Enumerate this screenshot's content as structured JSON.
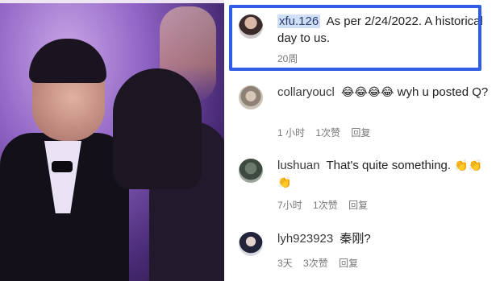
{
  "comments": [
    {
      "user": "xfu.126",
      "text": "As per 2/24/2022. A historical day to us.",
      "time": "20周",
      "likes": "",
      "reply": ""
    },
    {
      "user": "collaryoucl",
      "emoji": "😂😂😂😂",
      "text": "wyh u posted Q?",
      "time": "1 小时",
      "likes": "1次赞",
      "reply": "回复"
    },
    {
      "user": "lushuan",
      "text": "That's quite something.",
      "emoji": "👏👏👏",
      "time": "7小时",
      "likes": "1次赞",
      "reply": "回复"
    },
    {
      "user": "lyh923923",
      "text": "秦刚?",
      "time": "3天",
      "likes": "3次赞",
      "reply": "回复"
    }
  ],
  "colors": {
    "highlight_border": "#2f5de6",
    "username_highlight": "#cfe0f6"
  }
}
